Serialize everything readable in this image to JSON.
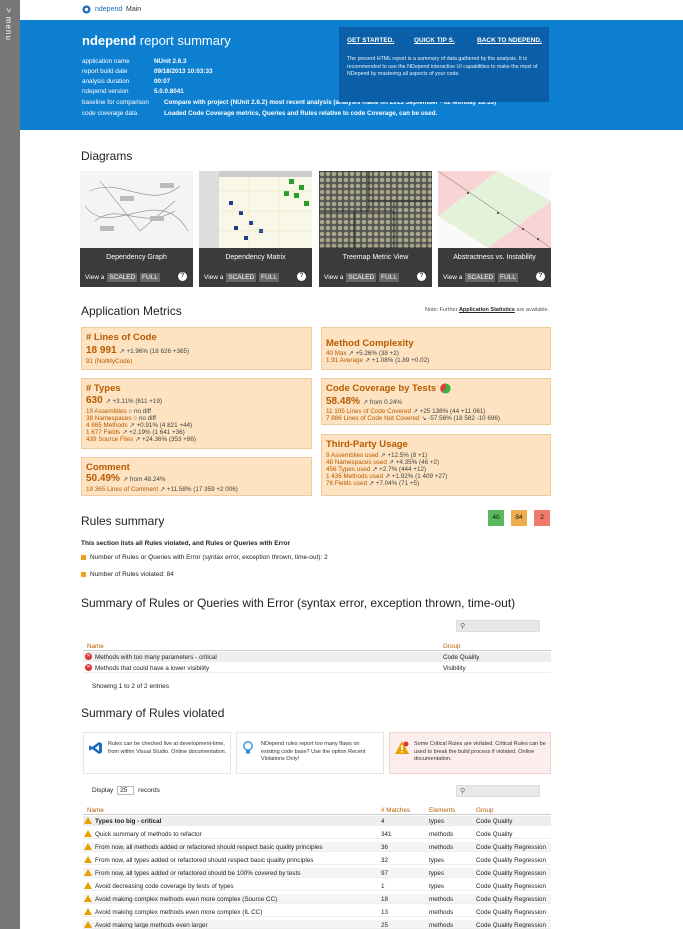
{
  "sidebar": {
    "label": "> menu"
  },
  "topbar": {
    "brand": "ndepend",
    "main": "Main"
  },
  "header": {
    "title_strong": "ndepend",
    "title_rest": " report summary",
    "rows": [
      {
        "k": "application name",
        "v": "NUnit 2.6.3"
      },
      {
        "k": "report build date",
        "v": "09/18/2013 10:03:33"
      },
      {
        "k": "analysis duration",
        "v": "00:07"
      },
      {
        "k": "ndepend version",
        "v": "5.0.0.8041"
      },
      {
        "k": "baseline for comparison",
        "v": "Compare with project {NUnit 2.6.2} most recent analysis (analysis made on 2013  September - 02 Monday 18:33)"
      },
      {
        "k": "code coverage data",
        "v": "Loaded Code Coverage metrics, Queries and Rules relative to code Coverage, can be used."
      }
    ],
    "nav": [
      "GET STARTED.",
      "QUICK TIP S.",
      "BACK TO NDEPEND."
    ],
    "nav_desc": "The present HTML report is a summary of data gathered by the analysis. It is recommended to use the NDepend interactive UI capabilities to make the most of NDepend by mastering all aspects of your code."
  },
  "diagrams": {
    "title": "Diagrams",
    "items": [
      {
        "caption": "Dependency Graph"
      },
      {
        "caption": "Dependency Matrix"
      },
      {
        "caption": "Treemap Metric View"
      },
      {
        "caption": "Abstractness vs. Instability"
      }
    ],
    "view_label": "View a",
    "scaled": "SCALED",
    "full": "FULL"
  },
  "metrics": {
    "title": "Application Metrics",
    "note_pre": "Note: Further ",
    "note_link": "Application Statistics",
    "note_post": " are available.",
    "loc": {
      "title": "# Lines of Code",
      "big": "18 991",
      "delta": "+1.96% (18 626 +365)",
      "sub": "91 (NotMyCode)"
    },
    "types": {
      "title": "# Types",
      "big": "630",
      "delta": "+3.11% (611 +19)",
      "lines": [
        {
          "n": "19",
          "label": "Assemblies",
          "d": "no diff"
        },
        {
          "n": "38",
          "label": "Namespaces",
          "d": "no diff"
        },
        {
          "n": "4 865",
          "label": "Methods",
          "d": "+0.91% (4 821 +44)"
        },
        {
          "n": "1 677",
          "label": "Fields",
          "d": "+2.19% (1 641 +36)"
        },
        {
          "n": "439",
          "label": "Source Files",
          "d": "+24.36% (353 +86)"
        }
      ]
    },
    "comment": {
      "title": "Comment",
      "big": "50.49%",
      "delta": "from 48.24%",
      "n": "19 365",
      "label": "Lines of Comment",
      "d": "+11.58% (17 359 +2 006)"
    },
    "complexity": {
      "title": "Method Complexity",
      "lines": [
        {
          "n": "40",
          "label": "Max",
          "d": "+5.26% (38 +2)"
        },
        {
          "n": "1.91",
          "label": "Average",
          "d": "+1.08% (1.89 +0.02)"
        }
      ]
    },
    "coverage": {
      "title": "Code Coverage by Tests",
      "big": "58.48%",
      "delta": "from 0.24%",
      "lines": [
        {
          "n": "11 105",
          "label": "Lines of Code Covered",
          "d": "+25 138% (44 +11 061)"
        },
        {
          "n": "7 886",
          "label": "Lines of Code Not Covered",
          "d": "-57.56% (18 582 -10 696)"
        }
      ]
    },
    "third": {
      "title": "Third-Party Usage",
      "lines": [
        {
          "n": "9",
          "label": "Assemblies used",
          "d": "+12.5% (8 +1)"
        },
        {
          "n": "48",
          "label": "Namespaces used",
          "d": "+4.35% (46 +2)"
        },
        {
          "n": "456",
          "label": "Types used",
          "d": "+2.7% (444 +12)"
        },
        {
          "n": "1 436",
          "label": "Methods used",
          "d": "+1.92% (1 409 +27)"
        },
        {
          "n": "76",
          "label": "Fields used",
          "d": "+7.04% (71 +5)"
        }
      ]
    }
  },
  "rules": {
    "title": "Rules summary",
    "badges": [
      "40",
      "84",
      "2"
    ],
    "intro": "This section lists all Rules violated, and Rules or Queries with Error",
    "item1": "Number of Rules or Queries with Error (syntax error, exception thrown, time-out): 2",
    "item2": "Number of Rules violated: 84"
  },
  "errors": {
    "title": "Summary of Rules or Queries with Error (syntax error, exception thrown, time-out)",
    "cols": [
      "Name",
      "Group"
    ],
    "rows": [
      {
        "name": "Methods with too many parameters - critical",
        "group": "Code Quality"
      },
      {
        "name": "Methods that could have a lower visibility",
        "group": "Visibility"
      }
    ],
    "showing": "Showing 1 to 2 of 2 entries"
  },
  "violated": {
    "title": "Summary of Rules violated",
    "info1": "Rules can be checked live at development-time, from within Visual Studio. Online documentation.",
    "info2": "NDepend rules report too many flaws on existing code base? Use the option Recent Violations Only!",
    "info3": "Some Critical Rules are violated. Critical Rules can be used to break the build process if violated. Online documentation.",
    "display_pre": "Display",
    "display_val": "25",
    "display_post": "records",
    "cols": [
      "Name",
      "# Matches",
      "Elements",
      "Group"
    ],
    "rows": [
      {
        "name": "Types too big - critical",
        "m": "4",
        "e": "types",
        "g": "Code Quality"
      },
      {
        "name": "Quick summary of methods to refactor",
        "m": "341",
        "e": "methods",
        "g": "Code Quality"
      },
      {
        "name": "From now, all methods added or refactored should respect basic quality principles",
        "m": "36",
        "e": "methods",
        "g": "Code Quality Regression"
      },
      {
        "name": "From now, all types added or refactored should respect basic quality principles",
        "m": "32",
        "e": "types",
        "g": "Code Quality Regression"
      },
      {
        "name": "From now, all types added or refactored should be 100% covered by tests",
        "m": "97",
        "e": "types",
        "g": "Code Quality Regression"
      },
      {
        "name": "Avoid decreasing code coverage by tests of types",
        "m": "1",
        "e": "types",
        "g": "Code Quality Regression"
      },
      {
        "name": "Avoid making complex methods even more complex (Source CC)",
        "m": "18",
        "e": "methods",
        "g": "Code Quality Regression"
      },
      {
        "name": "Avoid making complex methods even more complex (IL CC)",
        "m": "13",
        "e": "methods",
        "g": "Code Quality Regression"
      },
      {
        "name": "Avoid making large methods even larger",
        "m": "25",
        "e": "methods",
        "g": "Code Quality Regression"
      }
    ]
  }
}
